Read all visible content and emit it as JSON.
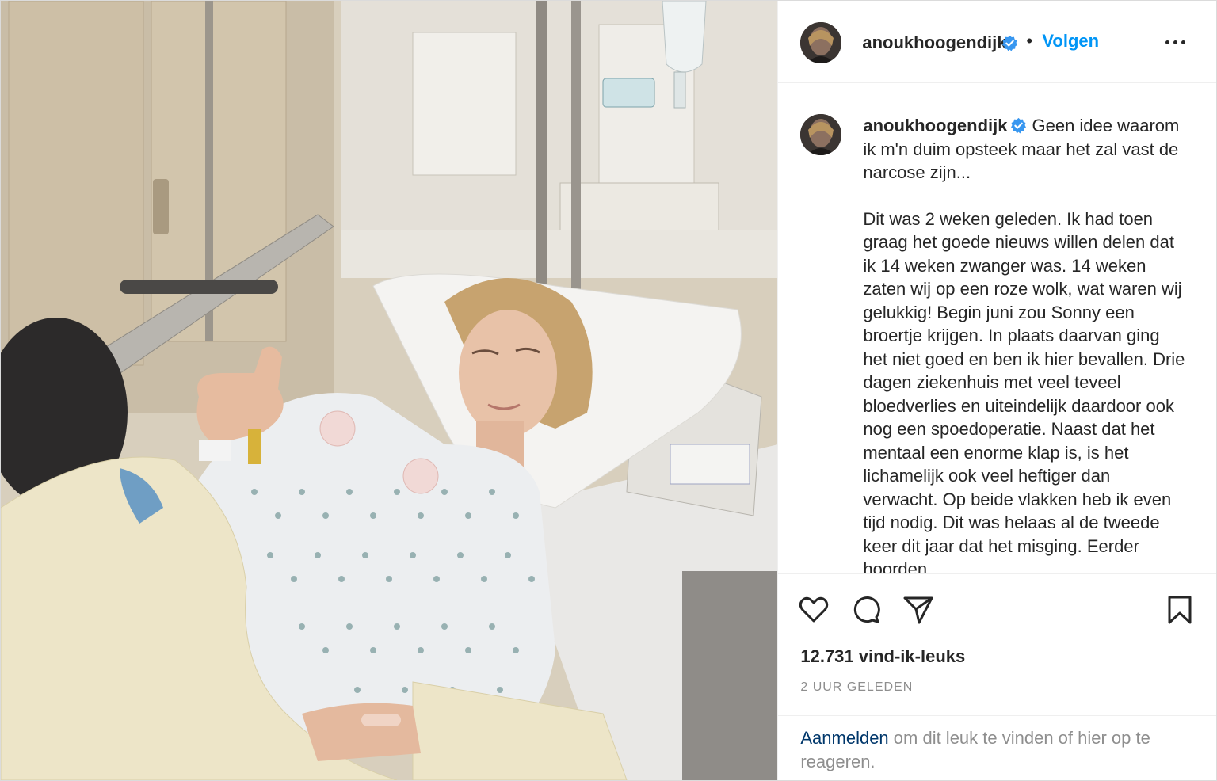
{
  "photo": {
    "alt": ""
  },
  "header": {
    "username": "anoukhoogendijk",
    "separator": "•",
    "follow_label": "Volgen"
  },
  "caption": {
    "username": "anoukhoogendijk",
    "first_paragraph": "Geen idee waarom ik m'n duim opsteek maar het zal vast de narcose zijn...",
    "second_paragraph": "Dit was 2 weken geleden. Ik had toen graag het goede nieuws willen delen dat ik 14 weken zwanger was. 14 weken zaten wij op een roze wolk, wat waren wij gelukkig! Begin juni zou Sonny een broertje krijgen. In plaats daarvan ging het niet goed en ben ik hier bevallen. Drie dagen ziekenhuis met veel teveel bloedverlies en uiteindelijk daardoor ook nog een spoedoperatie. Naast dat het mentaal een enorme klap is, is het lichamelijk ook veel heftiger dan verwacht. Op beide vlakken heb ik even tijd nodig. Dit was helaas al de tweede keer dit jaar dat het misging. Eerder hoorden"
  },
  "stats": {
    "likes": "12.731 vind-ik-leuks",
    "timestamp": "2 UUR GELEDEN"
  },
  "login": {
    "link": "Aanmelden",
    "rest": " om dit leuk te vinden of hier op te reageren."
  },
  "colors": {
    "link_blue": "#0095f6",
    "verified_blue": "#3897f0",
    "muted_gray": "#8e8e8e",
    "dark_link": "#00376b"
  }
}
